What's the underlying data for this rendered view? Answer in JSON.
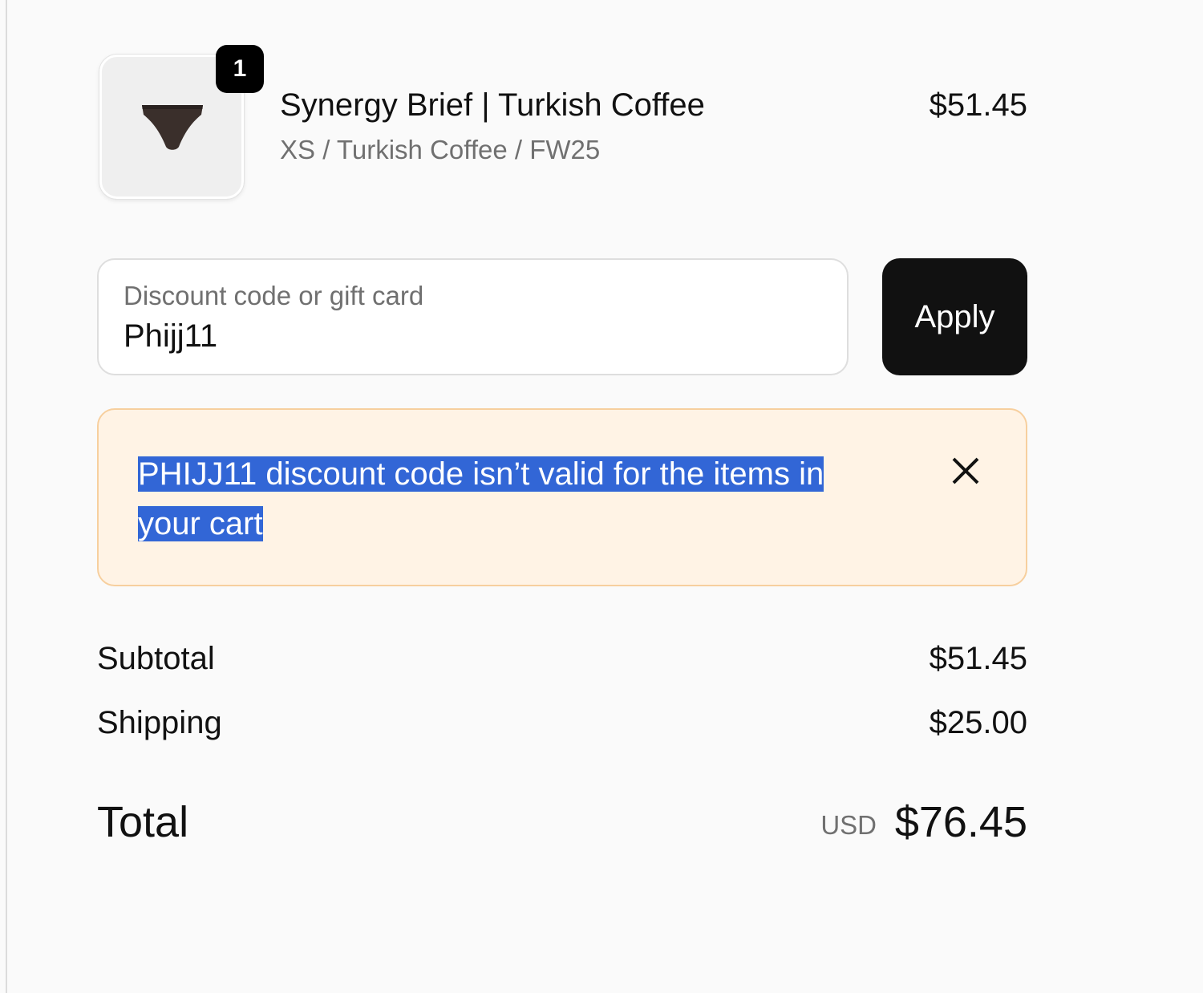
{
  "cart": {
    "items": [
      {
        "quantity": "1",
        "name": "Synergy Brief | Turkish Coffee",
        "variant": "XS / Turkish Coffee / FW25",
        "price": "$51.45",
        "image_icon": "brief-underwear-icon",
        "image_color": "#3a2f2b"
      }
    ]
  },
  "discount": {
    "label": "Discount code or gift card",
    "value": "Phijj11",
    "apply_label": "Apply"
  },
  "error": {
    "message": "PHIJJ11 discount code isn’t valid for the items in your cart",
    "close_icon": "close-icon"
  },
  "summary": {
    "subtotal_label": "Subtotal",
    "subtotal_value": "$51.45",
    "shipping_label": "Shipping",
    "shipping_value": "$25.00",
    "total_label": "Total",
    "total_currency": "USD",
    "total_value": "$76.45"
  },
  "colors": {
    "page_background": "#fafafa",
    "button_background": "#111111",
    "error_background": "#fff3e5",
    "error_border": "#f7cf9e",
    "text_selection": "#3266d6"
  }
}
